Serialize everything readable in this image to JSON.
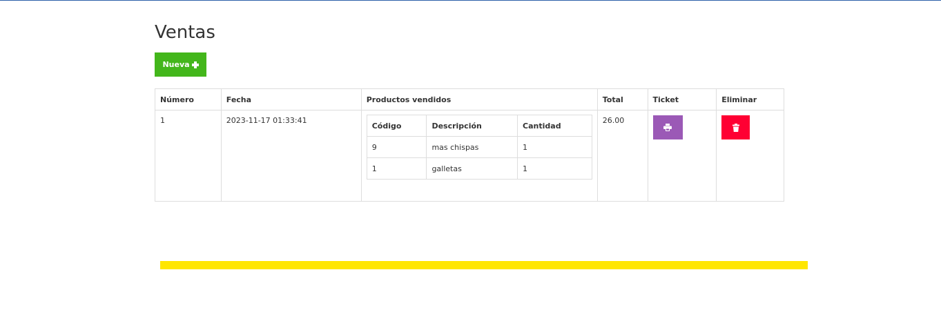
{
  "page": {
    "title": "Ventas"
  },
  "actions": {
    "new_label": "Nueva"
  },
  "table": {
    "headers": [
      "Número",
      "Fecha",
      "Productos vendidos",
      "Total",
      "Ticket",
      "Eliminar"
    ],
    "rows": [
      {
        "numero": "1",
        "fecha": "2023-11-17 01:33:41",
        "productos": {
          "headers": [
            "Código",
            "Descripción",
            "Cantidad"
          ],
          "items": [
            {
              "codigo": "9",
              "descripcion": "mas chispas",
              "cantidad": "1"
            },
            {
              "codigo": "1",
              "descripcion": "galletas",
              "cantidad": "1"
            }
          ]
        },
        "total": "26.00"
      }
    ]
  },
  "icons": {
    "new": "plus-icon",
    "ticket": "printer-icon",
    "delete": "trash-icon"
  },
  "colors": {
    "new_button": "#43b61b",
    "ticket_button": "#9b59b6",
    "delete_button": "#ff0033",
    "footer_bar": "#ffe600",
    "top_line": "#2b5fa8"
  }
}
